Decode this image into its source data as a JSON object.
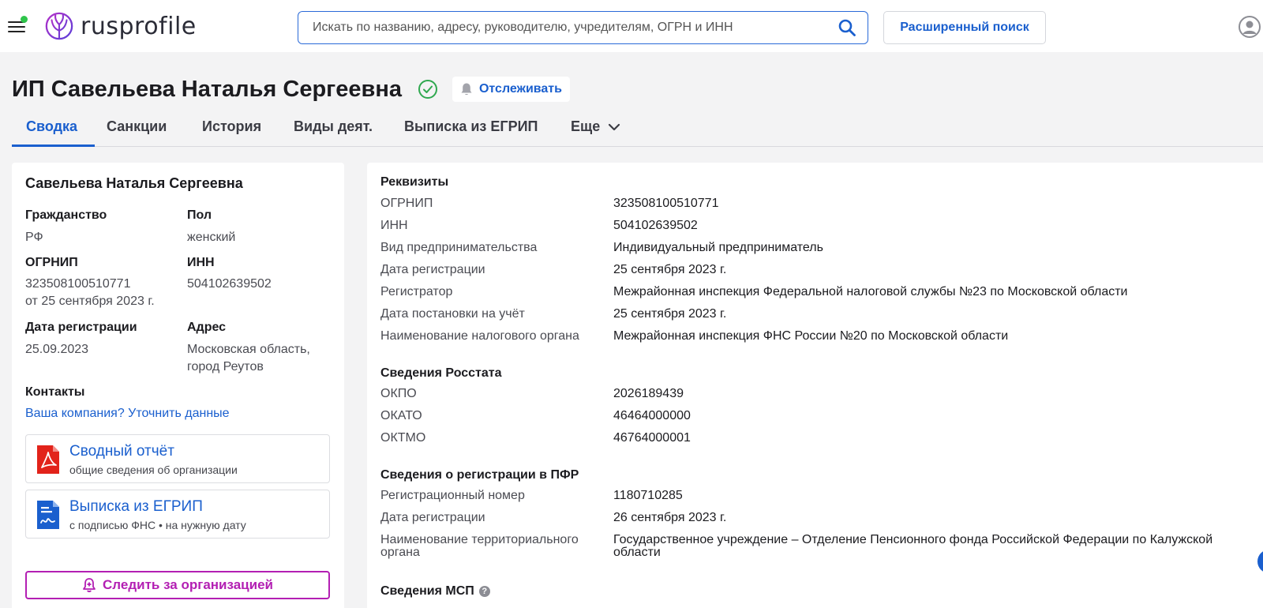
{
  "header": {
    "logo_text": "rusprofile",
    "search_placeholder": "Искать по названию, адресу, руководителю, учредителям, ОГРН и ИНН",
    "advanced_search_label": "Расширенный поиск"
  },
  "page": {
    "title": "ИП Савельева Наталья Сергеевна",
    "follow_label": "Отслеживать"
  },
  "tabs": [
    {
      "label": "Сводка"
    },
    {
      "label": "Санкции"
    },
    {
      "label": "История"
    },
    {
      "label": "Виды деят."
    },
    {
      "label": "Выписка из ЕГРИП"
    },
    {
      "label": "Еще"
    }
  ],
  "summary": {
    "name": "Савельева Наталья Сергеевна",
    "citizenship_label": "Гражданство",
    "citizenship_value": "РФ",
    "gender_label": "Пол",
    "gender_value": "женский",
    "ogrnip_label": "ОГРНИП",
    "ogrnip_value": "323508100510771",
    "ogrnip_date": "от 25 сентября 2023 г.",
    "inn_label": "ИНН",
    "inn_value": "504102639502",
    "reg_date_label": "Дата регистрации",
    "reg_date_value": "25.09.2023",
    "address_label": "Адрес",
    "address_line1": "Московская область,",
    "address_line2": "город Реутов",
    "contacts_label": "Контакты",
    "contacts_link": "Ваша компания? Уточнить данные",
    "report_title": "Сводный отчёт",
    "report_sub": "общие сведения об организации",
    "extract_title": "Выписка из ЕГРИП",
    "extract_sub": "с подписью ФНС • на нужную дату",
    "watch_label": "Следить за организацией"
  },
  "requisites": {
    "title": "Реквизиты",
    "rows": [
      {
        "key": "ОГРНИП",
        "value": "323508100510771"
      },
      {
        "key": "ИНН",
        "value": "504102639502"
      },
      {
        "key": "Вид предпринимательства",
        "value": "Индивидуальный предприниматель"
      },
      {
        "key": "Дата регистрации",
        "value": "25 сентября 2023 г."
      },
      {
        "key": "Регистратор",
        "value": "Межрайонная инспекция Федеральной налоговой службы №23 по Московской области"
      },
      {
        "key": "Дата постановки на учёт",
        "value": "25 сентября 2023 г."
      },
      {
        "key": "Наименование налогового органа",
        "value": "Межрайонная инспекция ФНС России №20 по Московской области"
      }
    ]
  },
  "rosstat": {
    "title": "Сведения Росстата",
    "rows": [
      {
        "key": "ОКПО",
        "value": "2026189439"
      },
      {
        "key": "ОКАТО",
        "value": "46464000000"
      },
      {
        "key": "ОКТМО",
        "value": "46764000001"
      }
    ]
  },
  "pfr": {
    "title": "Сведения о регистрации в ПФР",
    "rows": [
      {
        "key": "Регистрационный номер",
        "value": "1180710285"
      },
      {
        "key": "Дата регистрации",
        "value": "26 сентября 2023 г."
      },
      {
        "key_line1": "Наименование территориального",
        "key_line2": "органа",
        "value_line1": "Государственное учреждение – Отделение Пенсионного фонда Российской Федерации по Калужской",
        "value_line2": "области"
      }
    ]
  },
  "msp": {
    "title": "Сведения МСП",
    "help": "?"
  },
  "colors": {
    "accent": "#1a5fce",
    "watch": "#b31fb3",
    "verified": "#2fa84f",
    "online_dot": "#2fc54b"
  }
}
